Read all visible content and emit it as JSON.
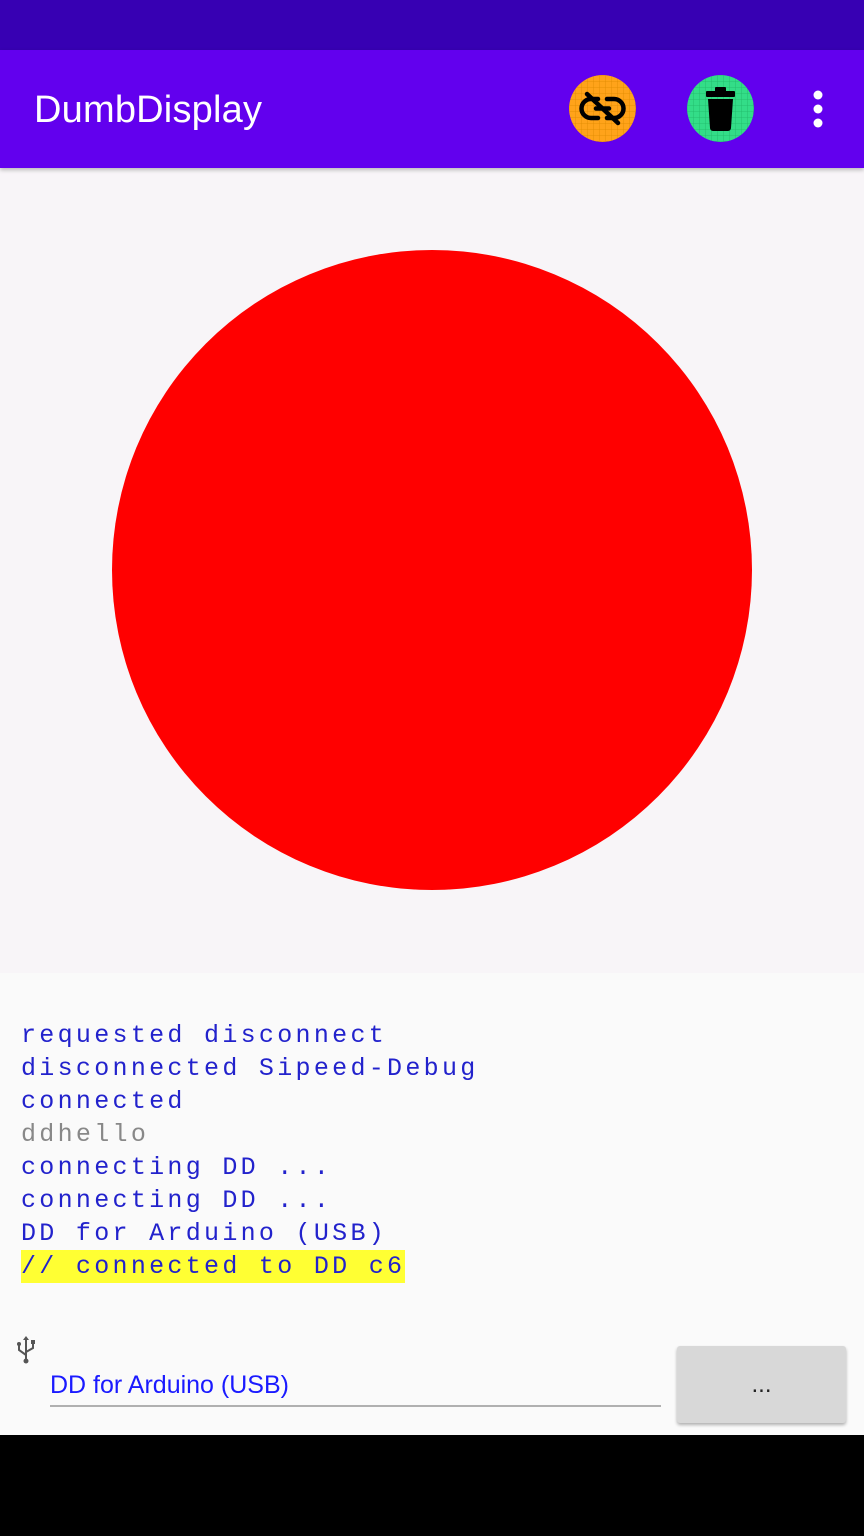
{
  "app_bar": {
    "title": "DumbDisplay",
    "disconnect_icon": "link-off-icon",
    "clear_icon": "trash-icon",
    "overflow_icon": "more-vert-icon"
  },
  "canvas": {
    "shape": "circle",
    "fill": "#ff0000",
    "background": "#f8f5f8"
  },
  "log": {
    "lines": [
      {
        "text": "requested disconnect",
        "color": "#2222cc",
        "highlight": null
      },
      {
        "text": "disconnected Sipeed-Debug",
        "color": "#2222cc",
        "highlight": null
      },
      {
        "text": "connected",
        "color": "#2222cc",
        "highlight": null
      },
      {
        "text": "ddhello",
        "color": "#888888",
        "highlight": null
      },
      {
        "text": "connecting DD ...",
        "color": "#2222cc",
        "highlight": null
      },
      {
        "text": "connecting DD ...",
        "color": "#2222cc",
        "highlight": null
      },
      {
        "text": "DD for Arduino (USB)",
        "color": "#2222cc",
        "highlight": null
      },
      {
        "text": "// connected to DD c6",
        "color": "#2222cc",
        "highlight": "#ffff33"
      }
    ]
  },
  "connection": {
    "icon": "usb-icon",
    "device_value": "DD for Arduino (USB)",
    "more_label": "..."
  },
  "colors": {
    "status_bar": "#3700b3",
    "app_bar": "#6200ee",
    "disconnect_button": "#ffa31a",
    "clear_button": "#33dd88"
  }
}
